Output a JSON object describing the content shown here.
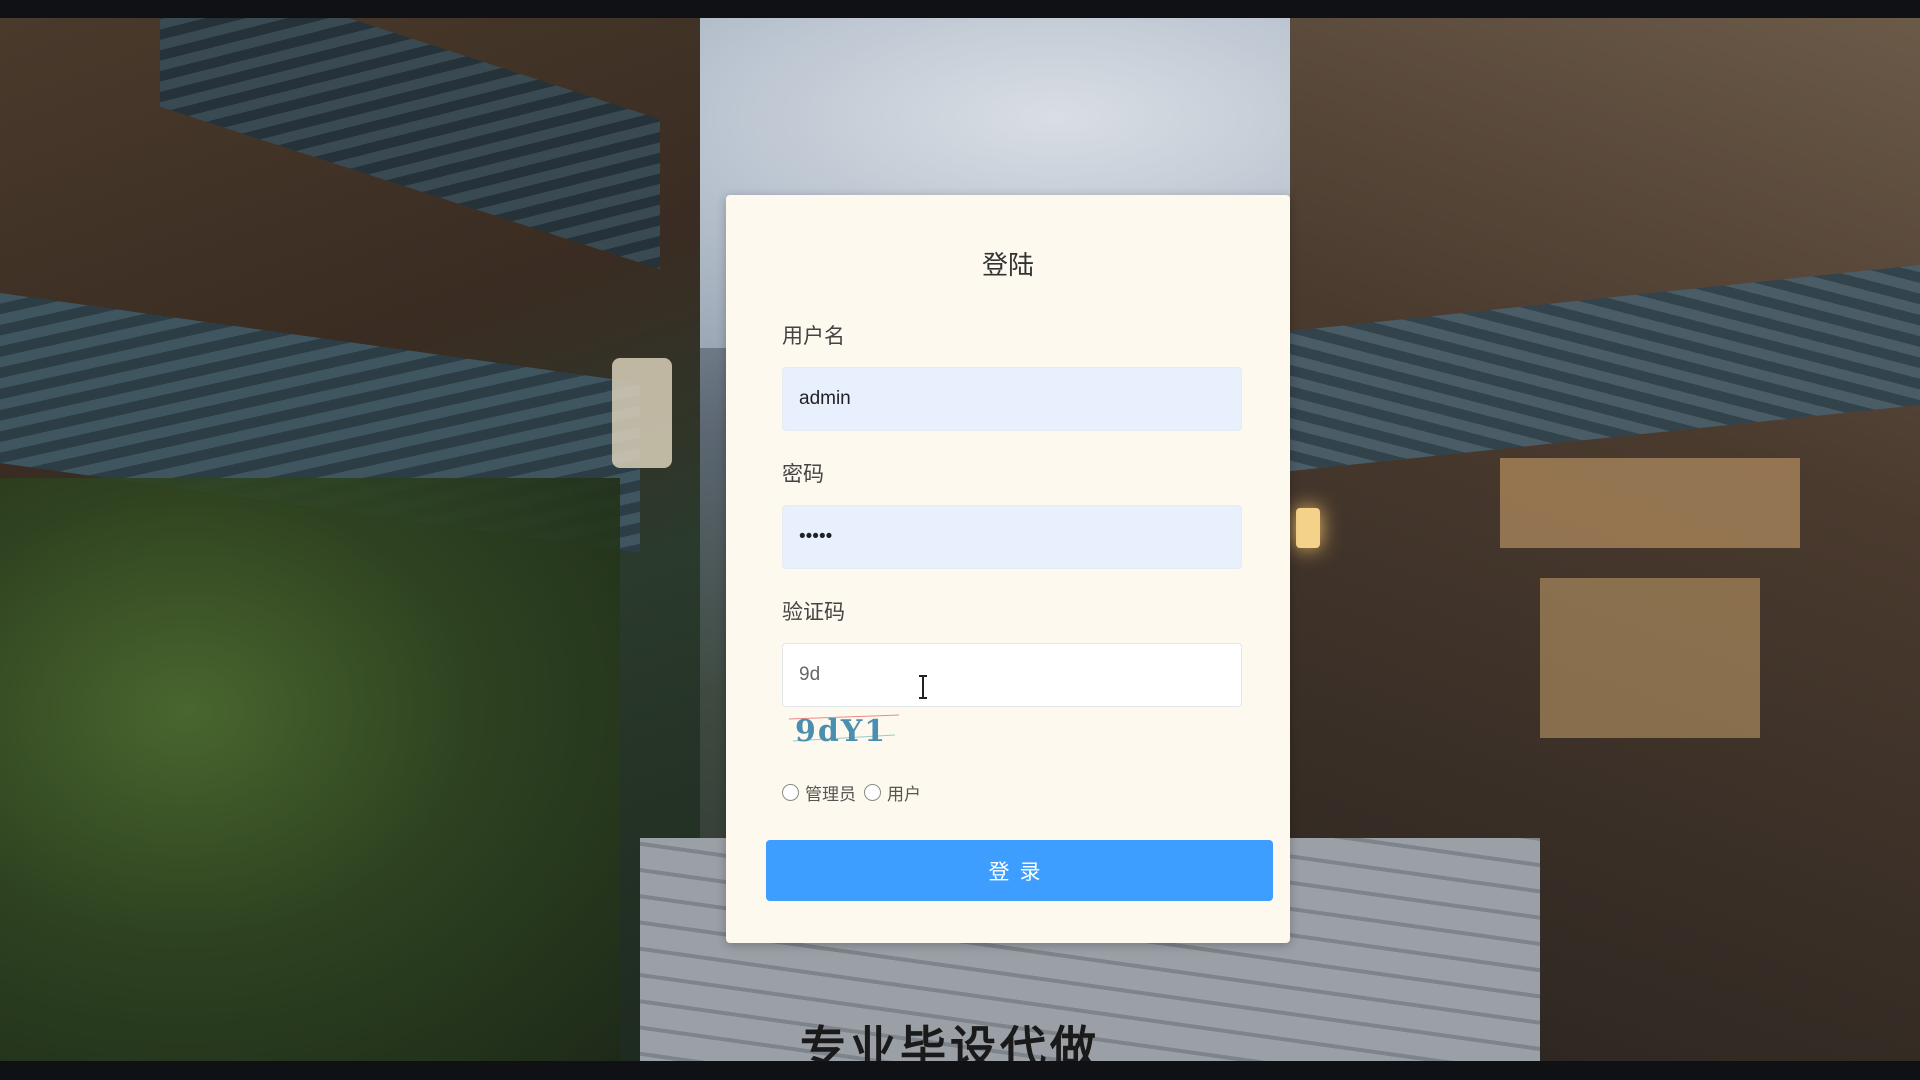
{
  "login": {
    "title": "登陆",
    "username_label": "用户名",
    "username_value": "admin",
    "password_label": "密码",
    "password_value": "•••••",
    "captcha_label": "验证码",
    "captcha_value": "9d",
    "captcha_image_text": "9dY1",
    "roles": [
      {
        "label": "管理员",
        "selected": false
      },
      {
        "label": "用户",
        "selected": false
      }
    ],
    "submit_label": "登录"
  },
  "caption": "专业毕设代做",
  "colors": {
    "card_bg": "#fdf9ee",
    "input_bg": "#e8f0fe",
    "button": "#3d9eff"
  }
}
